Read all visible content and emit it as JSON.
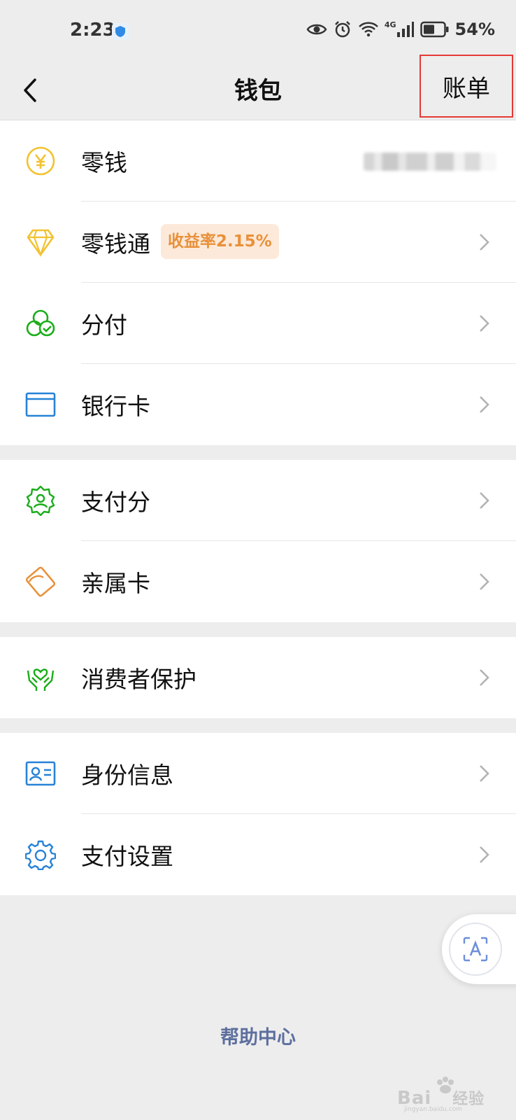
{
  "status_bar": {
    "time": "2:23",
    "network": "4G",
    "battery": "54%"
  },
  "header": {
    "title": "钱包",
    "back_icon": "back-arrow-icon",
    "bill_label": "账单"
  },
  "groups": [
    [
      {
        "icon": "yuan-coin-icon",
        "label": "零钱",
        "value_obscured": true
      },
      {
        "icon": "diamond-icon",
        "label": "零钱通",
        "badge": "收益率2.15%"
      },
      {
        "icon": "installment-icon",
        "label": "分付"
      },
      {
        "icon": "bank-card-icon",
        "label": "银行卡"
      }
    ],
    [
      {
        "icon": "payscore-icon",
        "label": "支付分"
      },
      {
        "icon": "family-card-icon",
        "label": "亲属卡"
      }
    ],
    [
      {
        "icon": "consumer-protection-icon",
        "label": "消费者保护"
      }
    ],
    [
      {
        "icon": "id-card-icon",
        "label": "身份信息"
      },
      {
        "icon": "settings-gear-icon",
        "label": "支付设置"
      }
    ]
  ],
  "help_center": "帮助中心",
  "floating_button_icon": "text-recognition-icon",
  "watermark": {
    "brand": "Bai",
    "suffix": "经验",
    "url": "jingyan.baidu.com"
  },
  "colors": {
    "bg": "#ededed",
    "badge_bg": "#fde9d9",
    "badge_text": "#e8913a",
    "highlight_box": "#e53935",
    "link": "#5d6f9e"
  }
}
